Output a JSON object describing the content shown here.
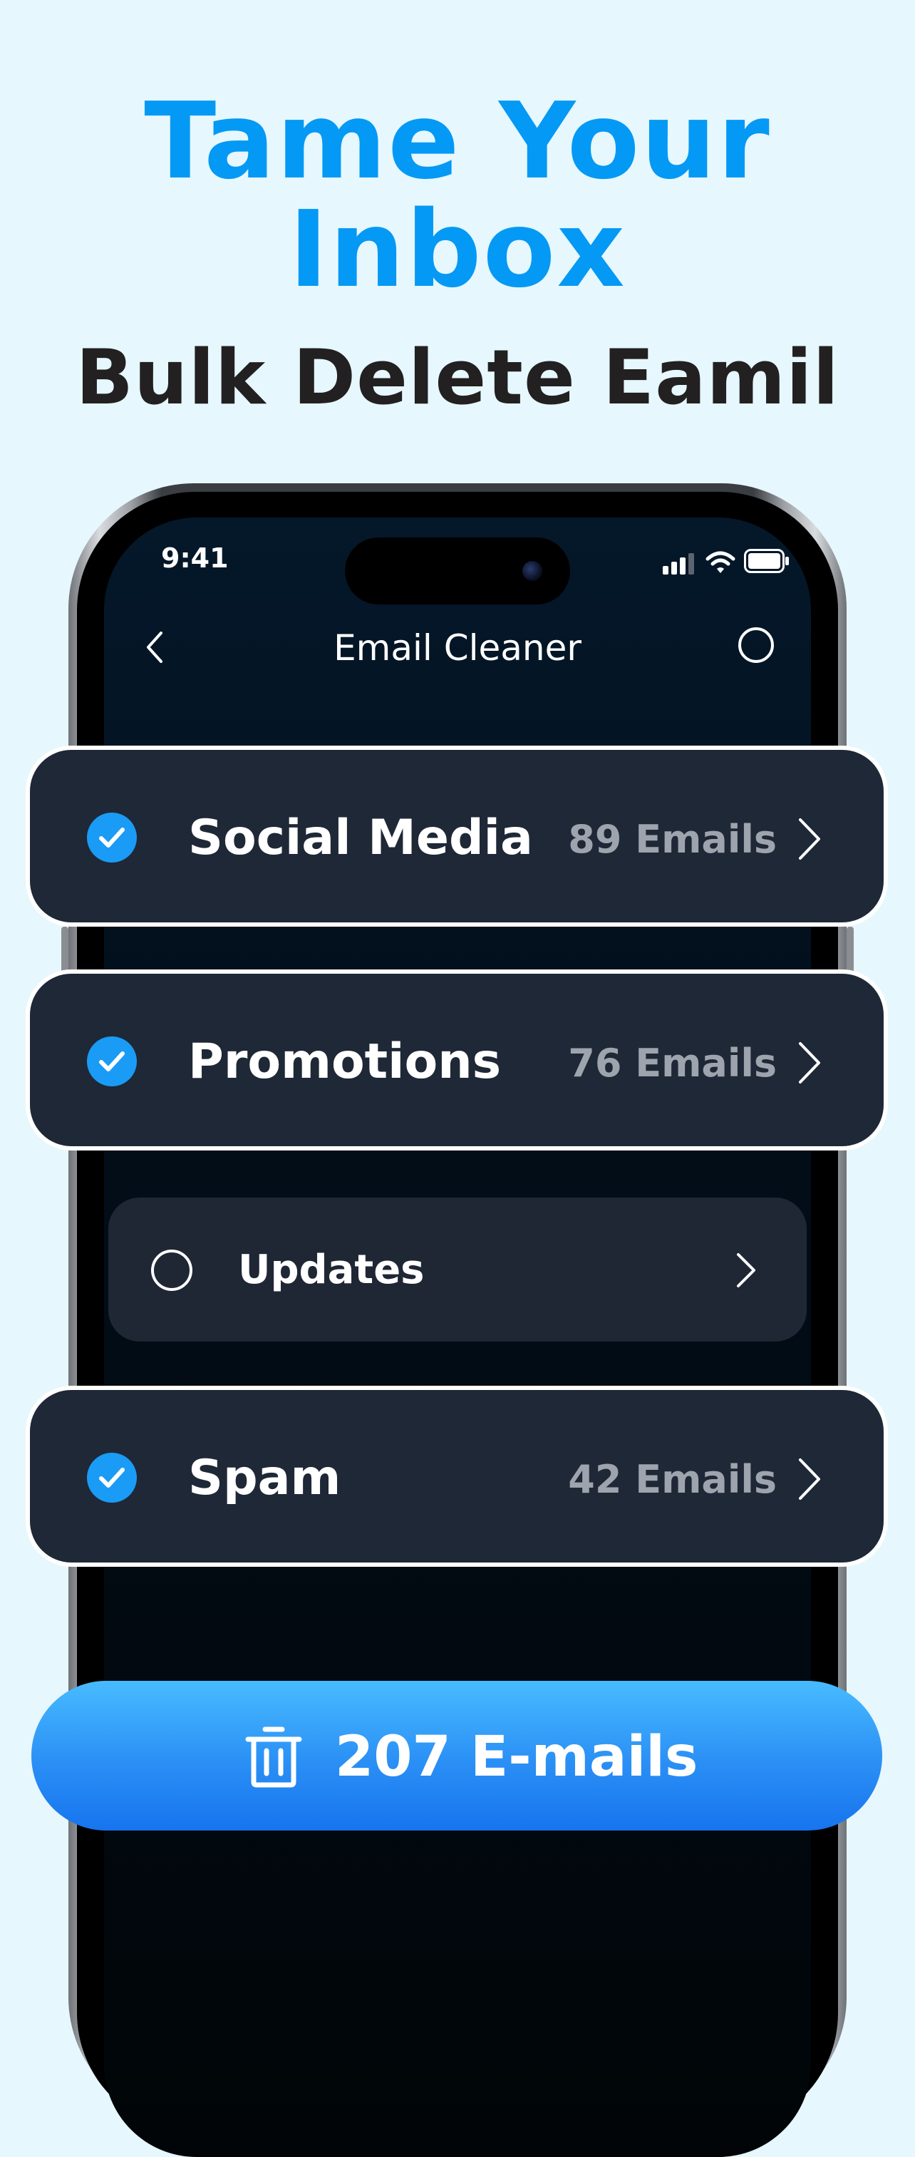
{
  "headline": {
    "line1": "Tame Your",
    "line2": "Inbox",
    "subtitle": "Bulk Delete Eamil"
  },
  "status_bar": {
    "time": "9:41"
  },
  "nav": {
    "title": "Email Cleaner"
  },
  "categories": [
    {
      "label": "Social Media",
      "count": "89 Emails",
      "selected": true
    },
    {
      "label": "Promotions",
      "count": "76 Emails",
      "selected": true
    },
    {
      "label": "Updates",
      "count": "",
      "selected": false
    },
    {
      "label": "Spam",
      "count": "42 Emails",
      "selected": true
    }
  ],
  "delete_button": {
    "label": "207 E-mails"
  },
  "colors": {
    "accent": "#0499f4",
    "check": "#1a9bf5",
    "card": "#1e2836",
    "button_top": "#48bbff",
    "button_bottom": "#1774ee"
  }
}
